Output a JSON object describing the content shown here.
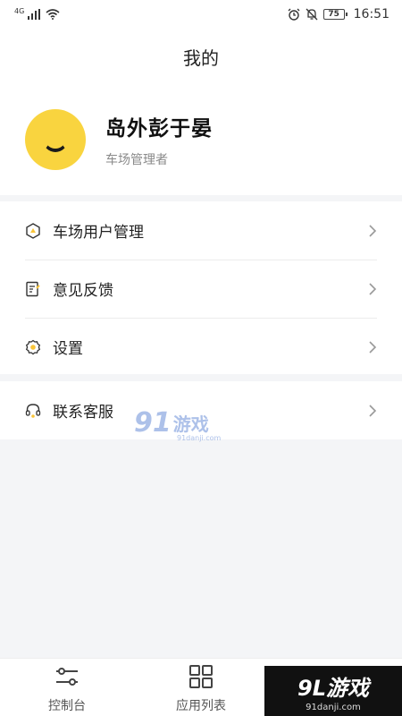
{
  "status_bar": {
    "network": "4G",
    "battery": "75",
    "time": "16:51"
  },
  "header": {
    "title": "我的"
  },
  "profile": {
    "name": "岛外彭于晏",
    "role": "车场管理者"
  },
  "menu": {
    "items": [
      {
        "label": "车场用户管理",
        "icon": "hexagon-user-icon"
      },
      {
        "label": "意见反馈",
        "icon": "feedback-icon"
      },
      {
        "label": "设置",
        "icon": "gear-icon"
      }
    ],
    "support": {
      "label": "联系客服",
      "icon": "headset-icon"
    }
  },
  "watermark": {
    "number": "91",
    "text": "游戏",
    "sub": "91danji.com"
  },
  "tab_bar": {
    "tabs": [
      {
        "label": "控制台",
        "icon": "sliders-icon"
      },
      {
        "label": "应用列表",
        "icon": "grid-icon"
      },
      {
        "label": "",
        "icon": "profile-icon"
      }
    ]
  },
  "brand": {
    "main": "9L游戏",
    "sub": "91danji.com"
  },
  "colors": {
    "accent": "#f9d43f",
    "background": "#f4f5f7"
  }
}
